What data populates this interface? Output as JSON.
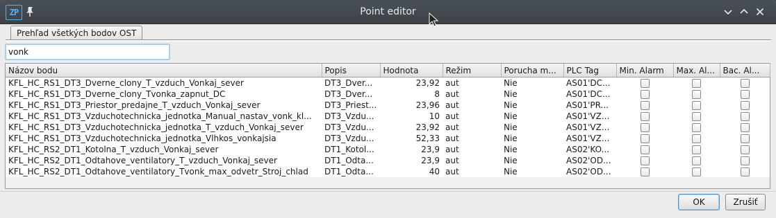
{
  "window": {
    "title": "Point editor",
    "app_icon_text": "ZP"
  },
  "tabs": [
    {
      "label": "Prehľad všetkých bodov OST",
      "active": true
    }
  ],
  "search": {
    "value": "vonk"
  },
  "table": {
    "columns": [
      "Názov bodu",
      "Popis",
      "Hodnota",
      "Režim",
      "Porucha m...",
      "PLC Tag",
      "Min. Alarm",
      "Max. Al...",
      "Bac. Al..."
    ],
    "rows": [
      {
        "name": "KFL_HC_RS1_DT3_Dverne_clony_T_vzduch_Vonkaj_sever",
        "popis": "DT3_Dver...",
        "hodnota": "23,92",
        "rezim": "aut",
        "porucha": "Nie",
        "plc": "AS01'DC...",
        "min": false,
        "max": false,
        "bac": false
      },
      {
        "name": "KFL_HC_RS1_DT3_Dverne_clony_Tvonka_zapnut_DC",
        "popis": "DT3_Dver...",
        "hodnota": "8",
        "rezim": "aut",
        "porucha": "Nie",
        "plc": "AS01'DC...",
        "min": false,
        "max": false,
        "bac": false
      },
      {
        "name": "KFL_HC_RS1_DT3_Priestor_predajne_T_vzduch_Vonkaj_sever",
        "popis": "DT3_Priest...",
        "hodnota": "23,96",
        "rezim": "aut",
        "porucha": "Nie",
        "plc": "AS01'PR...",
        "min": false,
        "max": false,
        "bac": false
      },
      {
        "name": "KFL_HC_RS1_DT3_Vzduchotechnicka_jednotka_Manual_nastav_vonk_kl...",
        "popis": "DT3_Vzdu...",
        "hodnota": "10",
        "rezim": "aut",
        "porucha": "Nie",
        "plc": "AS01'VZ...",
        "min": false,
        "max": false,
        "bac": false
      },
      {
        "name": "KFL_HC_RS1_DT3_Vzduchotechnicka_jednotka_T_vzduch_Vonkaj_sever",
        "popis": "DT3_Vzdu...",
        "hodnota": "23,92",
        "rezim": "aut",
        "porucha": "Nie",
        "plc": "AS01'VZ...",
        "min": false,
        "max": false,
        "bac": false
      },
      {
        "name": "KFL_HC_RS1_DT3_Vzduchotechnicka_jednotka_Vlhkos_vonkajsia",
        "popis": "DT3_Vzdu...",
        "hodnota": "52,33",
        "rezim": "aut",
        "porucha": "Nie",
        "plc": "AS01'VZ...",
        "min": false,
        "max": false,
        "bac": false
      },
      {
        "name": "KFL_HC_RS2_DT1_Kotolna_T_vzduch_Vonkaj_sever",
        "popis": "DT1_Kotol...",
        "hodnota": "23,9",
        "rezim": "aut",
        "porucha": "Nie",
        "plc": "AS02'KO...",
        "min": false,
        "max": false,
        "bac": false
      },
      {
        "name": "KFL_HC_RS2_DT1_Odtahove_ventilatory_T_vzduch_Vonkaj_sever",
        "popis": "DT1_Odta...",
        "hodnota": "23,9",
        "rezim": "aut",
        "porucha": "Nie",
        "plc": "AS02'OD...",
        "min": false,
        "max": false,
        "bac": false
      },
      {
        "name": "KFL_HC_RS2_DT1_Odtahove_ventilatory_Tvonk_max_odvetr_Stroj_chlad",
        "popis": "DT1_Odta...",
        "hodnota": "40",
        "rezim": "aut",
        "porucha": "Nie",
        "plc": "AS02'OD...",
        "min": false,
        "max": false,
        "bac": false
      }
    ]
  },
  "buttons": {
    "ok": "OK",
    "cancel": "Zrušiť"
  },
  "icons": {
    "app": "app-logo-icon",
    "pin": "pin-icon",
    "minimize": "minimize-icon",
    "maximize": "maximize-icon",
    "close": "close-icon"
  },
  "colors": {
    "titlebar": "#3c4248",
    "focus": "#a9cfee",
    "app_icon": "#5ab0e6"
  }
}
